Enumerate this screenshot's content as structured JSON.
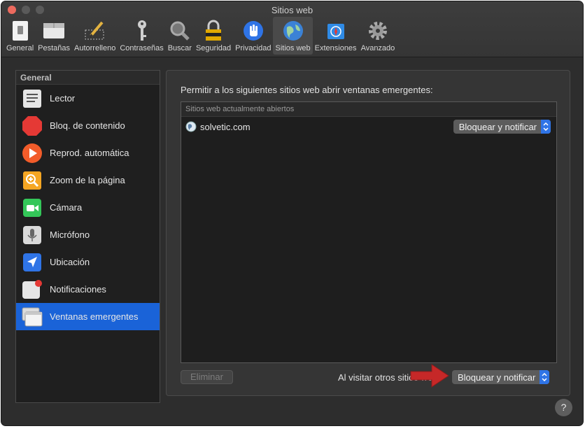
{
  "window": {
    "title": "Sitios web"
  },
  "toolbar": {
    "items": [
      {
        "label": "General",
        "icon": "general-icon"
      },
      {
        "label": "Pestañas",
        "icon": "tabs-icon"
      },
      {
        "label": "Autorrelleno",
        "icon": "autofill-icon"
      },
      {
        "label": "Contraseñas",
        "icon": "key-icon"
      },
      {
        "label": "Buscar",
        "icon": "search-icon"
      },
      {
        "label": "Seguridad",
        "icon": "lock-icon"
      },
      {
        "label": "Privacidad",
        "icon": "hand-icon"
      },
      {
        "label": "Sitios web",
        "icon": "globe-icon"
      },
      {
        "label": "Extensiones",
        "icon": "puzzle-icon"
      },
      {
        "label": "Avanzado",
        "icon": "gear-icon"
      }
    ],
    "active_index": 7
  },
  "sidebar": {
    "header": "General",
    "items": [
      {
        "label": "Lector",
        "icon": "reader-icon"
      },
      {
        "label": "Bloq. de contenido",
        "icon": "stop-sign-icon"
      },
      {
        "label": "Reprod. automática",
        "icon": "play-icon"
      },
      {
        "label": "Zoom de la página",
        "icon": "zoom-icon"
      },
      {
        "label": "Cámara",
        "icon": "camera-icon"
      },
      {
        "label": "Micrófono",
        "icon": "microphone-icon"
      },
      {
        "label": "Ubicación",
        "icon": "location-arrow-icon"
      },
      {
        "label": "Notificaciones",
        "icon": "notification-icon"
      },
      {
        "label": "Ventanas emergentes",
        "icon": "popup-windows-icon"
      }
    ],
    "selected_index": 8
  },
  "panel": {
    "description": "Permitir a los siguientes sitios web abrir ventanas emergentes:",
    "table_header": "Sitios web actualmente abiertos",
    "rows": [
      {
        "site": "solvetic.com",
        "setting": "Bloquear y notificar"
      }
    ],
    "remove_label": "Eliminar",
    "other_sites_label": "Al visitar otros sitios web:",
    "other_sites_setting": "Bloquear y notificar"
  },
  "help_label": "?",
  "colors": {
    "accent": "#1a63d8",
    "arrow": "#c62828"
  }
}
